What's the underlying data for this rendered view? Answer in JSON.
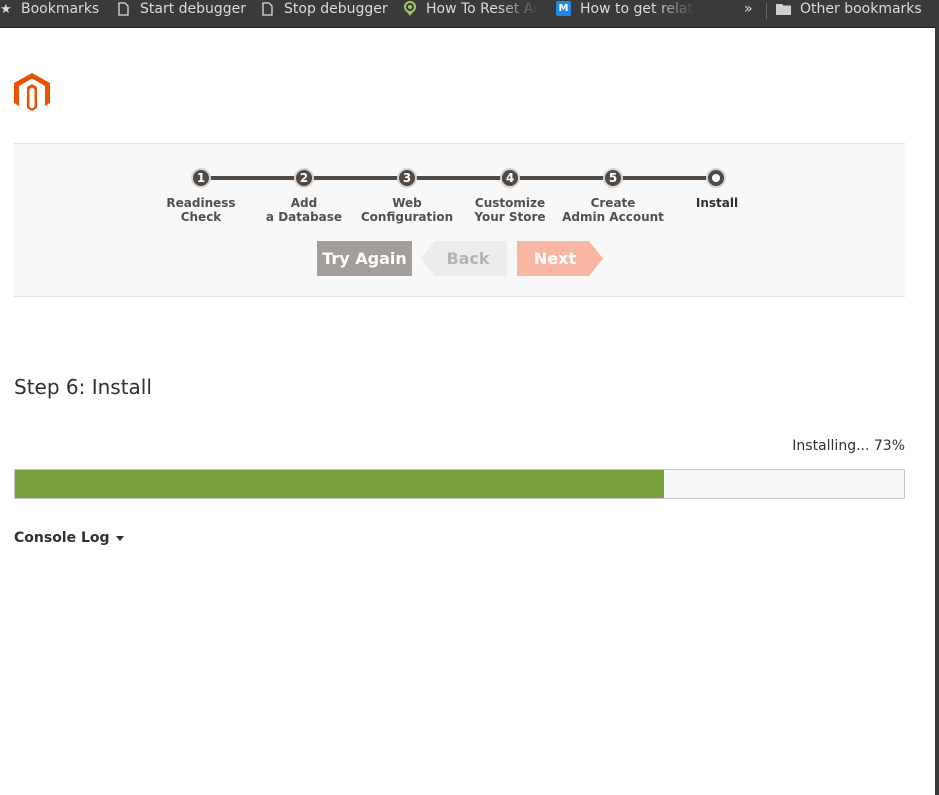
{
  "bookmarks": {
    "items": [
      {
        "label": "Bookmarks",
        "icon": "star-icon"
      },
      {
        "label": "Start debugger",
        "icon": "page-icon"
      },
      {
        "label": "Stop debugger",
        "icon": "page-icon"
      },
      {
        "label": "How To Reset Ad",
        "icon": "site-favicon"
      },
      {
        "label": "How to get relat",
        "icon": "m-favicon",
        "favicon_text": "M"
      }
    ],
    "overflow_label": "»",
    "other_bookmarks_label": "Other bookmarks"
  },
  "brand": {
    "logo": "magento-logo-icon",
    "logo_color": "#eb5202"
  },
  "wizard": {
    "steps": [
      {
        "number": "1",
        "label_line1": "Readiness",
        "label_line2": "Check"
      },
      {
        "number": "2",
        "label_line1": "Add",
        "label_line2": "a Database"
      },
      {
        "number": "3",
        "label_line1": "Web",
        "label_line2": "Configuration"
      },
      {
        "number": "4",
        "label_line1": "Customize",
        "label_line2": "Your Store"
      },
      {
        "number": "5",
        "label_line1": "Create",
        "label_line2": "Admin Account"
      },
      {
        "number": "",
        "label_line1": "Install",
        "label_line2": ""
      }
    ],
    "current_step": 6,
    "buttons": {
      "try_again": "Try Again",
      "back": "Back",
      "next": "Next"
    }
  },
  "content": {
    "step_title": "Step 6: Install",
    "progress_label": "Installing... 73%",
    "progress_percent": 73,
    "progress_color": "#79a23e",
    "console_log_label": "Console Log"
  }
}
